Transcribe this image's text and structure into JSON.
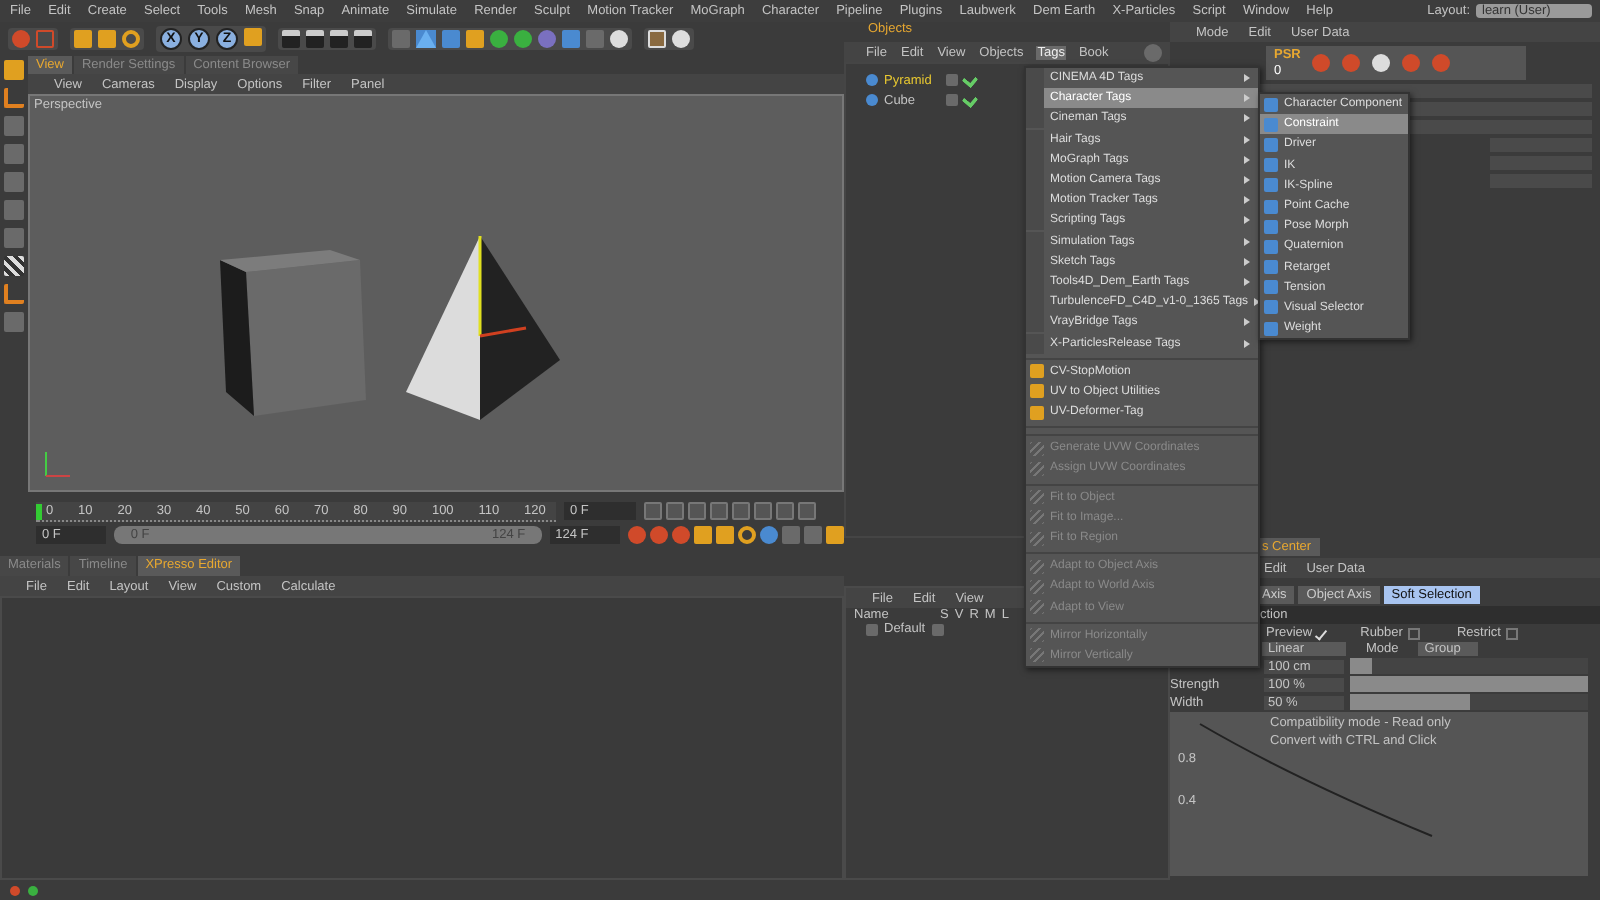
{
  "menu_bar": [
    "File",
    "Edit",
    "Create",
    "Select",
    "Tools",
    "Mesh",
    "Snap",
    "Animate",
    "Simulate",
    "Render",
    "Sculpt",
    "Motion Tracker",
    "MoGraph",
    "Character",
    "Pipeline",
    "Plugins",
    "Laubwerk",
    "Dem Earth",
    "X-Particles",
    "Script",
    "Window",
    "Help"
  ],
  "layout": {
    "label": "Layout:",
    "value": "learn (User)"
  },
  "axis_buttons": [
    "X",
    "Y",
    "Z"
  ],
  "viewport": {
    "tabs": [
      {
        "label": "View",
        "selected": true
      },
      {
        "label": "Render Settings",
        "selected": false
      },
      {
        "label": "Content Browser",
        "selected": false
      }
    ],
    "menu": [
      "View",
      "Cameras",
      "Display",
      "Options",
      "Filter",
      "Panel"
    ],
    "camera": "Perspective"
  },
  "timeline": {
    "ticks": [
      "0",
      "10",
      "20",
      "30",
      "40",
      "50",
      "60",
      "70",
      "80",
      "90",
      "100",
      "110",
      "120"
    ],
    "level": 0,
    "current_frame": "0 F",
    "start": "0 F",
    "range": {
      "start": "0 F",
      "end": "124 F",
      "level": 1
    },
    "end": "124 F"
  },
  "bottom_panel": {
    "tabs": [
      {
        "label": "Materials",
        "selected": false
      },
      {
        "label": "Timeline",
        "selected": false
      },
      {
        "label": "XPresso Editor",
        "selected": true
      }
    ],
    "menu": [
      "File",
      "Edit",
      "Layout",
      "View",
      "Custom",
      "Calculate"
    ]
  },
  "objects": {
    "title": "Objects",
    "menu": [
      {
        "label": "File",
        "selected": false
      },
      {
        "label": "Edit",
        "selected": false
      },
      {
        "label": "View",
        "selected": false
      },
      {
        "label": "Objects",
        "selected": false
      },
      {
        "label": "Tags",
        "selected": true
      },
      {
        "label": "Book",
        "selected": false
      }
    ],
    "items": [
      {
        "name": "Pyramid",
        "selected": true
      },
      {
        "name": "Cube",
        "selected": false
      }
    ]
  },
  "attributes": {
    "menu": [
      "Mode",
      "Edit",
      "User Data"
    ],
    "psr_label": "PSR",
    "psr_value": "0"
  },
  "layers": {
    "menu": [
      "File",
      "Edit",
      "View"
    ],
    "columns": [
      "Name",
      "S",
      "V",
      "R",
      "M",
      "L"
    ],
    "rows": [
      {
        "name": "Default"
      }
    ]
  },
  "attributes_lower": {
    "panel_tab": "s Center",
    "menu": [
      "Edit",
      "User Data"
    ],
    "tabs": [
      {
        "label": "Axis",
        "selected": false
      },
      {
        "label": "Object Axis",
        "selected": false
      },
      {
        "label": "Soft Selection",
        "selected": true
      }
    ],
    "section": "ction",
    "options": [
      {
        "label": "Preview",
        "checked": true
      },
      {
        "label": "Rubber",
        "checked": false
      },
      {
        "label": "Restrict",
        "checked": false
      }
    ],
    "falloff": "Linear",
    "mode_label": "Mode",
    "mode": "Group",
    "sliders": [
      {
        "value": "100 cm",
        "level": 0.09
      },
      {
        "label": "Strength",
        "value": "100 %",
        "level": 1
      },
      {
        "label": "Width",
        "value": "50 %",
        "level": 0.5
      }
    ],
    "graph_labels": [
      "0.8",
      "0.4"
    ],
    "notes": [
      "Compatibility mode - Read only",
      "Convert with CTRL and Click"
    ]
  },
  "tags_menu": [
    {
      "kind": "submenu",
      "label": "CINEMA 4D Tags",
      "selected": false,
      "disabled": false
    },
    {
      "kind": "submenu",
      "label": "Character Tags",
      "selected": true,
      "disabled": false
    },
    {
      "kind": "submenu",
      "label": "Cineman Tags",
      "selected": false,
      "disabled": false
    },
    {
      "kind": "submenu",
      "label": "Hair Tags",
      "selected": false,
      "disabled": false
    },
    {
      "kind": "submenu",
      "label": "MoGraph Tags",
      "selected": false,
      "disabled": false
    },
    {
      "kind": "submenu",
      "label": "Motion Camera Tags",
      "selected": false,
      "disabled": false
    },
    {
      "kind": "submenu",
      "label": "Motion Tracker Tags",
      "selected": false,
      "disabled": false
    },
    {
      "kind": "submenu",
      "label": "Scripting Tags",
      "selected": false,
      "disabled": false
    },
    {
      "kind": "submenu",
      "label": "Simulation Tags",
      "selected": false,
      "disabled": false
    },
    {
      "kind": "submenu",
      "label": "Sketch Tags",
      "selected": false,
      "disabled": false
    },
    {
      "kind": "submenu",
      "label": "Tools4D_Dem_Earth Tags",
      "selected": false,
      "disabled": false
    },
    {
      "kind": "submenu",
      "label": "TurbulenceFD_C4D_v1-0_1365 Tags",
      "selected": false,
      "disabled": false
    },
    {
      "kind": "submenu",
      "label": "VrayBridge Tags",
      "selected": false,
      "disabled": false
    },
    {
      "kind": "submenu",
      "label": "X-ParticlesRelease Tags",
      "selected": false,
      "disabled": false
    },
    {
      "kind": "separator"
    },
    {
      "kind": "item",
      "label": "CV-StopMotion",
      "selected": false,
      "disabled": false
    },
    {
      "kind": "item",
      "label": "UV to Object Utilities",
      "selected": false,
      "disabled": false
    },
    {
      "kind": "item",
      "label": "UV-Deformer-Tag",
      "selected": false,
      "disabled": false
    },
    {
      "kind": "separator"
    },
    {
      "kind": "separator"
    },
    {
      "kind": "item",
      "label": "Generate UVW Coordinates",
      "selected": false,
      "disabled": true
    },
    {
      "kind": "item",
      "label": "Assign UVW Coordinates",
      "selected": false,
      "disabled": true
    },
    {
      "kind": "separator"
    },
    {
      "kind": "item",
      "label": "Fit to Object",
      "selected": false,
      "disabled": true
    },
    {
      "kind": "item",
      "label": "Fit to Image...",
      "selected": false,
      "disabled": true
    },
    {
      "kind": "item",
      "label": "Fit to Region",
      "selected": false,
      "disabled": true
    },
    {
      "kind": "separator"
    },
    {
      "kind": "item",
      "label": "Adapt to Object Axis",
      "selected": false,
      "disabled": true
    },
    {
      "kind": "item",
      "label": "Adapt to World Axis",
      "selected": false,
      "disabled": true
    },
    {
      "kind": "item",
      "label": "Adapt to View",
      "selected": false,
      "disabled": true
    },
    {
      "kind": "separator"
    },
    {
      "kind": "item",
      "label": "Mirror Horizontally",
      "selected": false,
      "disabled": true
    },
    {
      "kind": "item",
      "label": "Mirror Vertically",
      "selected": false,
      "disabled": true
    }
  ],
  "character_submenu": [
    {
      "label": "Character Component",
      "selected": false
    },
    {
      "label": "Constraint",
      "selected": true
    },
    {
      "label": "Driver",
      "selected": false
    },
    {
      "label": "IK",
      "selected": false
    },
    {
      "label": "IK-Spline",
      "selected": false
    },
    {
      "label": "Point Cache",
      "selected": false
    },
    {
      "label": "Pose Morph",
      "selected": false
    },
    {
      "label": "Quaternion",
      "selected": false
    },
    {
      "label": "Retarget",
      "selected": false
    },
    {
      "label": "Tension",
      "selected": false
    },
    {
      "label": "Visual Selector",
      "selected": false
    },
    {
      "label": "Weight",
      "selected": false
    }
  ]
}
